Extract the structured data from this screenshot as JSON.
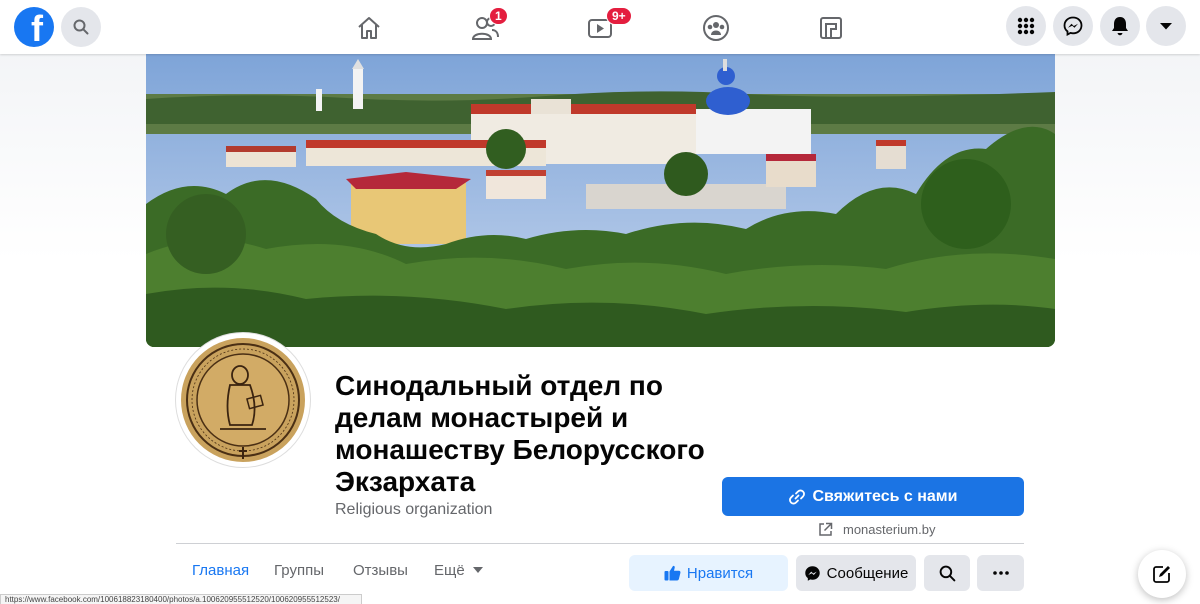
{
  "topbar": {
    "friends_badge": "1",
    "watch_badge": "9+",
    "icons": [
      "facebook-logo",
      "search-icon",
      "home-icon",
      "friends-icon",
      "watch-icon",
      "groups-icon",
      "gaming-icon",
      "menu-grid-icon",
      "messenger-icon",
      "notifications-icon",
      "account-dropdown-icon"
    ]
  },
  "page": {
    "title": "Синодальный отдел по делам монастырей и монашеству Белорусского Экзархата",
    "category": "Religious organization",
    "contact_button": "Свяжитесь с нами",
    "website": "monasterium.by"
  },
  "tabs": {
    "home": "Главная",
    "groups": "Группы",
    "reviews": "Отзывы",
    "more": "Ещё"
  },
  "actions": {
    "like": "Нравится",
    "message": "Сообщение"
  },
  "status_url": "https://www.facebook.com/100618823180400/photos/a.100620955512520/100620955512523/",
  "colors": {
    "accent": "#1877f2",
    "badge": "#e41e3f",
    "button_gray": "#e4e6eb"
  }
}
